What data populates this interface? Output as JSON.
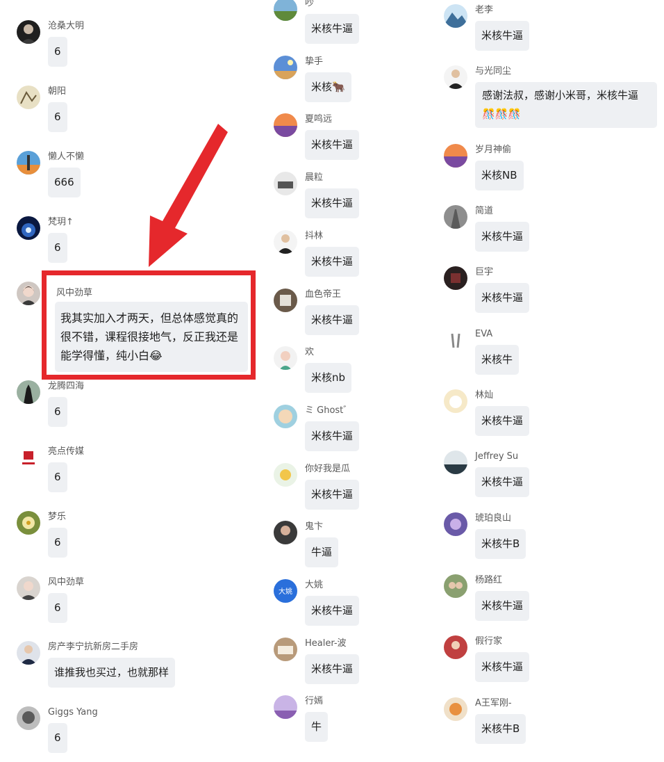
{
  "columns": [
    {
      "messages": [
        {
          "name": "沧桑大明",
          "text": "6",
          "avatar": "dark-portrait"
        },
        {
          "name": "朝阳",
          "text": "6",
          "avatar": "sketch"
        },
        {
          "name": "懒人不懒",
          "text": "666",
          "avatar": "tower"
        },
        {
          "name": "梵玥↑",
          "text": "6",
          "avatar": "blue-glow"
        },
        {
          "name": "龙腾四海",
          "text": "6",
          "avatar": "silhouette"
        },
        {
          "name": "亮点传媒",
          "text": "6",
          "avatar": "logo-d"
        },
        {
          "name": "梦乐",
          "text": "6",
          "avatar": "flower"
        },
        {
          "name": "风中劲草",
          "text": "6",
          "avatar": "girl"
        },
        {
          "name": "房产李宁抗新房二手房",
          "text": "谁推我也买过，也就那样",
          "avatar": "suit"
        },
        {
          "name": "Giggs Yang",
          "text": "6",
          "avatar": "bw-face"
        }
      ]
    },
    {
      "messages": [
        {
          "name": "吵",
          "text": "米核牛逼",
          "avatar": "landscape"
        },
        {
          "name": "挚手",
          "text": "米核🐂",
          "avatar": "sky"
        },
        {
          "name": "夏鸣远",
          "text": "米核牛逼",
          "avatar": "sunset"
        },
        {
          "name": "晨粒",
          "text": "米核牛逼",
          "avatar": "building"
        },
        {
          "name": "抖林",
          "text": "米核牛逼",
          "avatar": "man-suit"
        },
        {
          "name": "血色帝王",
          "text": "米核牛逼",
          "avatar": "room"
        },
        {
          "name": "欢",
          "text": "米核nb",
          "avatar": "anime"
        },
        {
          "name": "ミ Ghost゛",
          "text": "米核牛逼",
          "avatar": "cartoon"
        },
        {
          "name": "你好我是瓜",
          "text": "米核牛逼",
          "avatar": "sun"
        },
        {
          "name": "鬼卞",
          "text": "牛逼",
          "avatar": "person"
        },
        {
          "name": "大姚",
          "text": "米核牛逼",
          "avatar": "text-badge",
          "badge": "大姚"
        },
        {
          "name": "Healer-波",
          "text": "米核牛逼",
          "avatar": "desk"
        },
        {
          "name": "行嫣",
          "text": "牛",
          "avatar": "lavender"
        }
      ]
    },
    {
      "messages": [
        {
          "name": "老李",
          "text": "米核牛逼",
          "avatar": "mountain"
        },
        {
          "name": "与光同尘",
          "text": "感谢法叔，感谢小米哥，米核牛逼🎊🎊🎊",
          "avatar": "man-suit",
          "big": true
        },
        {
          "name": "岁月神偷",
          "text": "米核NB",
          "avatar": "sunset"
        },
        {
          "name": "简道",
          "text": "米核牛逼",
          "avatar": "road"
        },
        {
          "name": "巨宇",
          "text": "米核牛逼",
          "avatar": "dark-room"
        },
        {
          "name": "EVA",
          "text": "米核牛",
          "avatar": "peace"
        },
        {
          "name": "林灿",
          "text": "米核牛逼",
          "avatar": "cute"
        },
        {
          "name": "Jeffrey Su",
          "text": "米核牛逼",
          "avatar": "lake"
        },
        {
          "name": "琥珀良山",
          "text": "米核牛B",
          "avatar": "purple"
        },
        {
          "name": "杨路红",
          "text": "米核牛逼",
          "avatar": "group"
        },
        {
          "name": "假行家",
          "text": "米核牛逼",
          "avatar": "people"
        },
        {
          "name": "A王军刚-",
          "text": "米核牛B",
          "avatar": "orange"
        }
      ]
    }
  ],
  "highlight": {
    "name": "风中劲草",
    "text": "我其实加入才两天，但总体感觉真的很不错，课程很接地气，反正我还是能学得懂，纯小白😂",
    "border_color": "#e5282c"
  },
  "colors": {
    "bubble": "#eef0f3",
    "name_text": "#595959",
    "body_text": "#1e1e1e",
    "annotation": "#e5282c"
  }
}
